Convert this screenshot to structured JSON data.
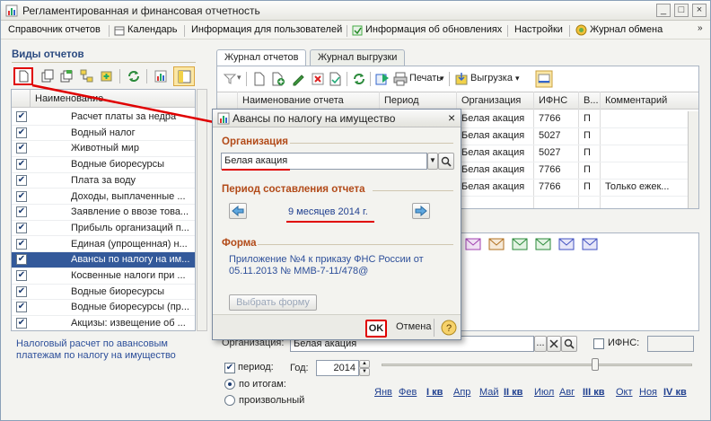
{
  "window": {
    "title": "Регламентированная и финансовая отчетность"
  },
  "menu": {
    "items": [
      "Справочник отчетов",
      "Календарь",
      "Информация для пользователей",
      "Информация об обновлениях",
      "Настройки",
      "Журнал обмена"
    ]
  },
  "sidebar": {
    "title": "Виды отчетов",
    "column_header": "Наименование",
    "items": [
      {
        "label": "Расчет платы за недра"
      },
      {
        "label": "Водный налог"
      },
      {
        "label": "Животный мир"
      },
      {
        "label": "Водные биоресурсы"
      },
      {
        "label": "Плата за воду"
      },
      {
        "label": "Доходы, выплаченные ..."
      },
      {
        "label": "Заявление о ввозе това..."
      },
      {
        "label": "Прибыль организаций п..."
      },
      {
        "label": "Единая (упрощенная) н..."
      },
      {
        "label": "Авансы по налогу на им..."
      },
      {
        "label": "Косвенные налоги при ..."
      },
      {
        "label": "Водные биоресурсы"
      },
      {
        "label": "Водные биоресурсы (пр..."
      },
      {
        "label": "Акцизы: извещение об ..."
      }
    ],
    "selected_index": 9,
    "description": "Налоговый расчет по авансовым платежам по налогу на имущество"
  },
  "tabs": [
    "Журнал отчетов",
    "Журнал выгрузки"
  ],
  "toolbar": {
    "print_label": "Печать",
    "export_label": "Выгрузка"
  },
  "grid": {
    "columns": [
      "Наименование отчета",
      "Период",
      "Организация",
      "ИФНС",
      "В...",
      "Комментарий"
    ],
    "rows": [
      {
        "org": "Белая акация",
        "ifns": "7766",
        "v": "П",
        "comment": ""
      },
      {
        "org": "Белая акация",
        "ifns": "5027",
        "v": "П",
        "comment": ""
      },
      {
        "org": "Белая акация",
        "ifns": "5027",
        "v": "П",
        "comment": ""
      },
      {
        "org": "Белая акация",
        "ifns": "7766",
        "v": "П",
        "comment": ""
      },
      {
        "org": "Белая акация",
        "ifns": "7766",
        "v": "П",
        "comment": "Только ежек..."
      }
    ]
  },
  "filter": {
    "org_label": "Организация:",
    "org_value": "Белая акация",
    "ifns_label": "ИФНС:",
    "period_label": "период:",
    "year_label": "Год:",
    "year_value": "2014",
    "radio_totals": "по итогам:",
    "radio_custom": "произвольный",
    "months": [
      "Янв",
      "Фев",
      "I кв",
      "Апр",
      "Май",
      "II кв",
      "Июл",
      "Авг",
      "III кв",
      "Окт",
      "Ноя",
      "IV кв"
    ]
  },
  "dialog": {
    "title": "Авансы по налогу на имущество",
    "org_section": "Организация",
    "org_value": "Белая акация",
    "period_section": "Период составления отчета",
    "period_value": "9 месяцев 2014 г.",
    "form_section": "Форма",
    "form_text": "Приложение №4 к приказу ФНС России от 05.11.2013 № ММВ-7-11/478@",
    "choose_form": "Выбрать форму",
    "ok": "OK",
    "cancel": "Отмена"
  },
  "colors": {
    "accent": "#33599a",
    "section": "#b24a18",
    "annotation": "#e00000"
  }
}
